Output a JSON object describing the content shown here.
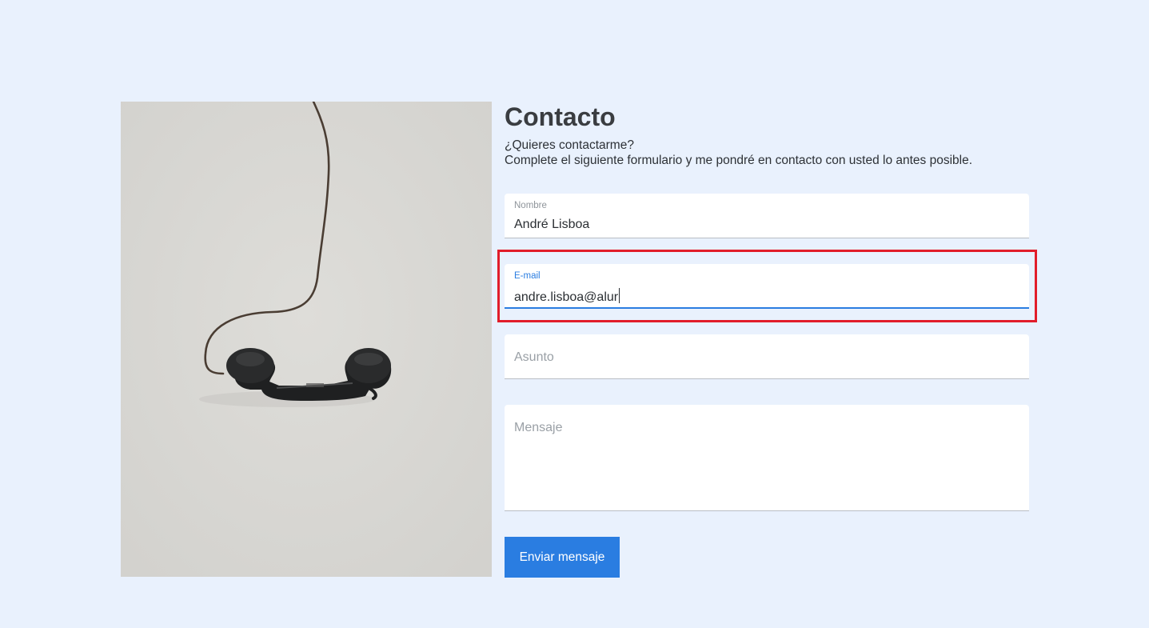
{
  "contact": {
    "title": "Contacto",
    "subtitle_line1": "¿Quieres contactarme?",
    "subtitle_line2": "Complete el siguiente formulario y me pondré en contacto con usted lo antes posible."
  },
  "form": {
    "nombre": {
      "label": "Nombre",
      "value": "André Lisboa"
    },
    "email": {
      "label": "E-mail",
      "value": "andre.lisboa@alur"
    },
    "asunto": {
      "placeholder": "Asunto"
    },
    "mensaje": {
      "placeholder": "Mensaje"
    },
    "submit_label": "Enviar mensaje"
  },
  "colors": {
    "page_background": "#e9f1fd",
    "accent": "#2a7de1",
    "highlight_border": "#e11d2a",
    "photo_background": "#d8d7d3"
  },
  "icons": {
    "photo": "telephone-handset-image"
  }
}
